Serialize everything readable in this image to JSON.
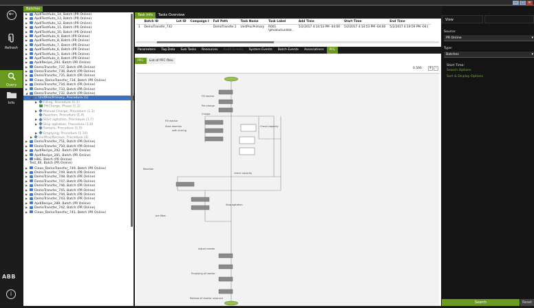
{
  "window": {
    "minimize": "–",
    "maximize": "□",
    "close": "✕"
  },
  "leftbar": {
    "back_icon": "back-arrow-icon",
    "refresh_label": "Refresh",
    "query_label": "Query",
    "info_label": "Info",
    "logo": "ABB",
    "info_button": "i"
  },
  "tree": {
    "tab_label": "Batches",
    "rows": [
      {
        "indent": 0,
        "arrow": "▶",
        "icon": "batch",
        "text": "ApdlTestAuto_14, Batch (PR Online)"
      },
      {
        "indent": 0,
        "arrow": "▶",
        "icon": "batch",
        "text": "ApdlTestAuto_13, Batch (PR Online)"
      },
      {
        "indent": 0,
        "arrow": "▶",
        "icon": "batch",
        "text": "ApdlTestAuto_12, Batch (PR Online)"
      },
      {
        "indent": 0,
        "arrow": "▶",
        "icon": "batch",
        "text": "ApdlTestAuto_11, Batch (PR Online)"
      },
      {
        "indent": 0,
        "arrow": "▶",
        "icon": "batch",
        "text": "ApdlTestAuto_10, Batch (PR Online)"
      },
      {
        "indent": 0,
        "arrow": "▶",
        "icon": "batch",
        "text": "ApdlTestAuto_9, Batch (PR Online)"
      },
      {
        "indent": 0,
        "arrow": "▶",
        "icon": "batch",
        "text": "ApdlTestAuto_8, Batch (PR Online)"
      },
      {
        "indent": 0,
        "arrow": "▶",
        "icon": "batch",
        "text": "ApdlTestAuto_7, Batch (PR Online)"
      },
      {
        "indent": 0,
        "arrow": "▶",
        "icon": "batch",
        "text": "ApdlTestAuto_6, Batch (PR Online)"
      },
      {
        "indent": 0,
        "arrow": "▶",
        "icon": "batch",
        "text": "ApdlTestAuto_5, Batch (PR Online)"
      },
      {
        "indent": 0,
        "arrow": "▶",
        "icon": "batch",
        "text": "ApdlTestAuto_4, Batch (PR Online)"
      },
      {
        "indent": 0,
        "arrow": "▶",
        "icon": "batch",
        "text": "ApdlRecipe_293, Batch (PR Online)"
      },
      {
        "indent": 0,
        "arrow": "▶",
        "icon": "batch",
        "text": "DemoTransfer_737, Batch (PR Online)"
      },
      {
        "indent": 0,
        "arrow": "▶",
        "icon": "batch",
        "text": "DemoTransfer_736, Batch (PR Online)"
      },
      {
        "indent": 0,
        "arrow": "▶",
        "icon": "batch",
        "text": "DemoTransfer_735, Batch (PR Online)"
      },
      {
        "indent": 0,
        "arrow": "▶",
        "icon": "batch",
        "text": "Clean_DemoTransfer_734, Batch (PR Online)"
      },
      {
        "indent": 0,
        "arrow": "▶",
        "icon": "batch",
        "text": "DemoTransfer_734, Batch (PR Online)"
      },
      {
        "indent": 0,
        "arrow": "▶",
        "icon": "batch",
        "text": "DemoTransfer_733, Batch (PR Online)"
      },
      {
        "indent": 0,
        "arrow": "◢",
        "icon": "batch",
        "text": "DemoTransfer_732, Batch (PR Online)"
      },
      {
        "indent": 1,
        "arrow": "◢",
        "icon": "proc",
        "text": "UnitProcPrimary, Procedure (1)",
        "selected": true
      },
      {
        "indent": 2,
        "arrow": "▶",
        "icon": "proc",
        "text": "Filling, Procedure (1.1)",
        "dim": true
      },
      {
        "indent": 2,
        "arrow": "",
        "icon": "phase",
        "text": "PHCharge, Phase (1.2)",
        "dim": true
      },
      {
        "indent": 2,
        "arrow": "▶",
        "icon": "proc",
        "text": "Manual Charge, Procedure (1.3)",
        "dim": true
      },
      {
        "indent": 2,
        "arrow": "",
        "icon": "proc",
        "text": "Reaction, Procedure (1.4)",
        "dim": true
      },
      {
        "indent": 2,
        "arrow": "▶",
        "icon": "proc",
        "text": "Start agitation, Procedure (1.7)",
        "dim": true
      },
      {
        "indent": 2,
        "arrow": "▶",
        "icon": "proc",
        "text": "Stop agitation, Procedure (1.8)",
        "dim": true
      },
      {
        "indent": 2,
        "arrow": "",
        "icon": "proc",
        "text": "Sample, Procedure (1.9)",
        "dim": true
      },
      {
        "indent": 2,
        "arrow": "▶",
        "icon": "proc",
        "text": "Emptying, Procedure (1.10)",
        "dim": true
      },
      {
        "indent": 1,
        "arrow": "▶",
        "icon": "proc",
        "text": "UnitProcRecieve, Procedure (4)",
        "dim": true
      },
      {
        "indent": 0,
        "arrow": "▶",
        "icon": "batch",
        "text": "DemoTransfer_751, Batch (PR Online)"
      },
      {
        "indent": 0,
        "arrow": "▶",
        "icon": "batch",
        "text": "DemoTransfer_750, Batch (PR Online)"
      },
      {
        "indent": 0,
        "arrow": "▶",
        "icon": "batch",
        "text": "ApdlRecipe_292, Batch (PR Online)"
      },
      {
        "indent": 0,
        "arrow": "▶",
        "icon": "batch",
        "text": "ApdlRecipe_291, Batch (PR Online)"
      },
      {
        "indent": 0,
        "arrow": "▶",
        "icon": "batch",
        "text": "HBG, Batch (PR Online)"
      },
      {
        "indent": 0,
        "arrow": "",
        "icon": "none",
        "text": "Test_40, Batch (PR Online)"
      },
      {
        "indent": 0,
        "arrow": "▶",
        "icon": "batch",
        "text": "Clean_DemoTransfer_749, Batch (PR Online)"
      },
      {
        "indent": 0,
        "arrow": "▶",
        "icon": "batch",
        "text": "DemoTransfer_749, Batch (PR Online)"
      },
      {
        "indent": 0,
        "arrow": "▶",
        "icon": "batch",
        "text": "DemoTransfer_748, Batch (PR Online)"
      },
      {
        "indent": 0,
        "arrow": "▶",
        "icon": "batch",
        "text": "DemoTransfer_747, Batch (PR Online)"
      },
      {
        "indent": 0,
        "arrow": "▶",
        "icon": "batch",
        "text": "DemoTransfer_746, Batch (PR Online)"
      },
      {
        "indent": 0,
        "arrow": "▶",
        "icon": "batch",
        "text": "DemoTransfer_745, Batch (PR Online)"
      },
      {
        "indent": 0,
        "arrow": "▶",
        "icon": "batch",
        "text": "DemoTransfer_744, Batch (PR Online)"
      },
      {
        "indent": 0,
        "arrow": "▶",
        "icon": "batch",
        "text": "DemoTransfer_743, Batch (PR Online)"
      },
      {
        "indent": 0,
        "arrow": "▶",
        "icon": "batch",
        "text": "ApdlRecipe_289, Batch (PR Online)"
      },
      {
        "indent": 0,
        "arrow": "▶",
        "icon": "batch",
        "text": "DemoTransfer_742, Batch (PR Online)"
      },
      {
        "indent": 0,
        "arrow": "▶",
        "icon": "batch",
        "text": "Clean_DemoTransfer_741, Batch (PR Online)"
      }
    ]
  },
  "main": {
    "top_tabs": [
      {
        "label": "Task Info",
        "active": true
      },
      {
        "label": "Tasks Overview",
        "active": false
      }
    ],
    "grid": {
      "headers": [
        "",
        "Batch ID",
        "Lot ID",
        "Campaign I",
        "Full Path",
        "Task Name",
        "Task Label",
        "Add Time",
        "Start Time",
        "End Time"
      ],
      "rows": [
        [
          "1",
          "DemoTransfer_732",
          "",
          "",
          "DemoTransfer.1",
          "UnitProcPrimary",
          "R001 \\phvalue\\unitstr...",
          "5/2/2017 4:14:53 PM -04:00",
          "5/2/2017 4:14:53 PM -04:00",
          "5/2/2017 4:19:59 PM -04:("
        ]
      ]
    },
    "detail_tabs": [
      {
        "label": "Parameters",
        "state": "normal"
      },
      {
        "label": "Tag Data",
        "state": "normal"
      },
      {
        "label": "Sub Tasks",
        "state": "normal"
      },
      {
        "label": "Resources",
        "state": "normal"
      },
      {
        "label": "Audit Events",
        "state": "dim"
      },
      {
        "label": "System Events",
        "state": "normal"
      },
      {
        "label": "Batch Events",
        "state": "normal"
      },
      {
        "label": "Associations",
        "state": "normal"
      },
      {
        "label": "PFC",
        "state": "active"
      }
    ],
    "pfc_tabs": [
      {
        "label": "PFC",
        "active": true
      },
      {
        "label": "List of PFC files",
        "active": false
      }
    ],
    "zoom_value": "0.566",
    "zoom_plus": "+",
    "zoom_minus": "-",
    "pfc_labels": {
      "fill_reactor": "Fill reactor",
      "pre_charge": "Pre-charge",
      "charge": "Charge",
      "fill_reactor_2": "Fill reactor",
      "check_capacity": "Check capacity",
      "start_reaction": "Start reaction",
      "with_stirring": "with stirring",
      "stop_agitation": "Stop agitation",
      "reaction": "Reaction",
      "check_capacity_2": "check capacity",
      "pre_filter": "pre filter",
      "adjust_reactor": "Adjust reactor",
      "emptying": "Emptying of reactor",
      "release": "Release of reactor resource"
    }
  },
  "right": {
    "view_tab": "View",
    "source_label": "Source:",
    "source_value": "PR Online",
    "type_label": "Type:",
    "type_value": "Batches",
    "start_time": "Start Time:",
    "search_options": "Search Options",
    "sort_options": "Sort & Display Options",
    "search_button": "Search",
    "reset_button": "Reset"
  },
  "colors": {
    "accent": "#6a9a1f",
    "selection": "#3b73c3"
  }
}
